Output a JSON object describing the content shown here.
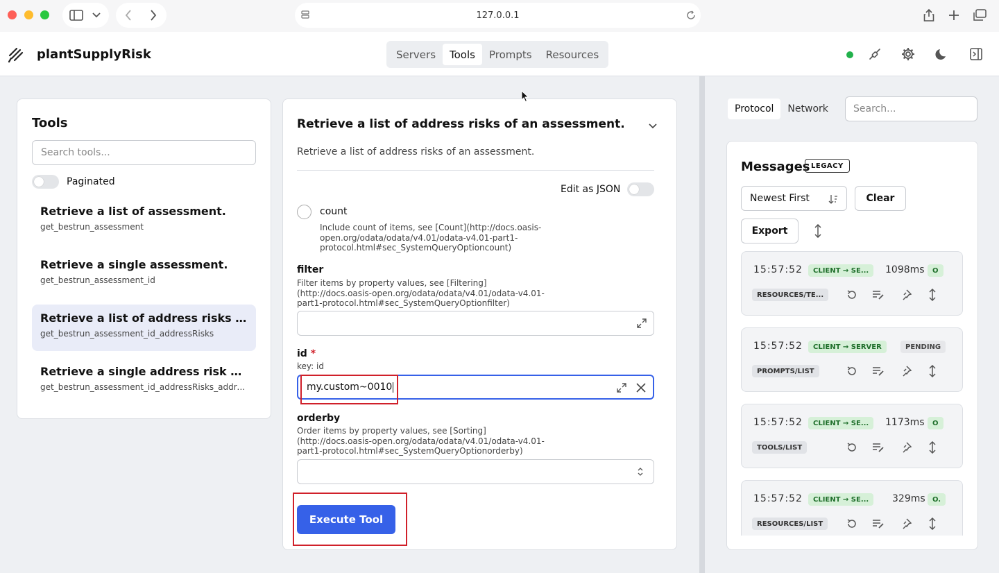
{
  "browser": {
    "url": "127.0.0.1"
  },
  "header": {
    "app_title": "plantSupplyRisk",
    "tabs": [
      {
        "label": "Servers"
      },
      {
        "label": "Tools"
      },
      {
        "label": "Prompts"
      },
      {
        "label": "Resources"
      }
    ],
    "active_tab": "Tools",
    "status_color": "#22b14c"
  },
  "tools_panel": {
    "title": "Tools",
    "search_placeholder": "Search tools...",
    "paginated_label": "Paginated",
    "items": [
      {
        "name": "Retrieve a list of assessment.",
        "id": "get_bestrun_assessment"
      },
      {
        "name": "Retrieve a single assessment.",
        "id": "get_bestrun_assessment_id"
      },
      {
        "name": "Retrieve a list of address risks of an assessment.",
        "id": "get_bestrun_assessment_id_addressRisks"
      },
      {
        "name": "Retrieve a single address risk of an assessment.",
        "id": "get_bestrun_assessment_id_addressRisks_addressRiskId"
      }
    ],
    "selected_index": 2
  },
  "tool_form": {
    "title": "Retrieve a list of address risks of an assessment.",
    "description": "Retrieve a list of address risks of an assessment.",
    "edit_json_label": "Edit as JSON",
    "count": {
      "label": "count",
      "desc": "Include count of items, see [Count](http://docs.oasis-open.org/odata/odata/v4.01/odata-v4.01-part1-protocol.html#sec_SystemQueryOptioncount)"
    },
    "filter": {
      "label": "filter",
      "desc": "Filter items by property values, see [Filtering](http://docs.oasis-open.org/odata/odata/v4.01/odata-v4.01-part1-protocol.html#sec_SystemQueryOptionfilter)",
      "value": ""
    },
    "id": {
      "label": "id",
      "required_mark": "*",
      "desc": "key: id",
      "value": "my.custom~0010"
    },
    "orderby": {
      "label": "orderby",
      "desc": "Order items by property values, see [Sorting](http://docs.oasis-open.org/odata/odata/v4.01/odata-v4.01-part1-protocol.html#sec_SystemQueryOptionorderby)",
      "value": ""
    },
    "execute_label": "Execute Tool",
    "accent_color": "#3661e8",
    "highlight_color": "#d0202a"
  },
  "right_pane": {
    "tabs": [
      {
        "label": "Protocol"
      },
      {
        "label": "Network"
      }
    ],
    "search_placeholder": "Search...",
    "messages_title": "Messages",
    "legacy_badge": "LEGACY",
    "sort_value": "Newest First",
    "clear_label": "Clear",
    "export_label": "Export",
    "messages": [
      {
        "time": "15:57:52",
        "direction": "CLIENT → SE...",
        "duration": "1098ms",
        "status": "O",
        "method": "RESOURCES/TE..."
      },
      {
        "time": "15:57:52",
        "direction": "CLIENT → SERVER",
        "duration": "",
        "status": "PENDING",
        "method": "PROMPTS/LIST"
      },
      {
        "time": "15:57:52",
        "direction": "CLIENT → SE...",
        "duration": "1173ms",
        "status": "O",
        "method": "TOOLS/LIST"
      },
      {
        "time": "15:57:52",
        "direction": "CLIENT → SE...",
        "duration": "329ms",
        "status": "O.",
        "method": "RESOURCES/LIST"
      }
    ]
  }
}
